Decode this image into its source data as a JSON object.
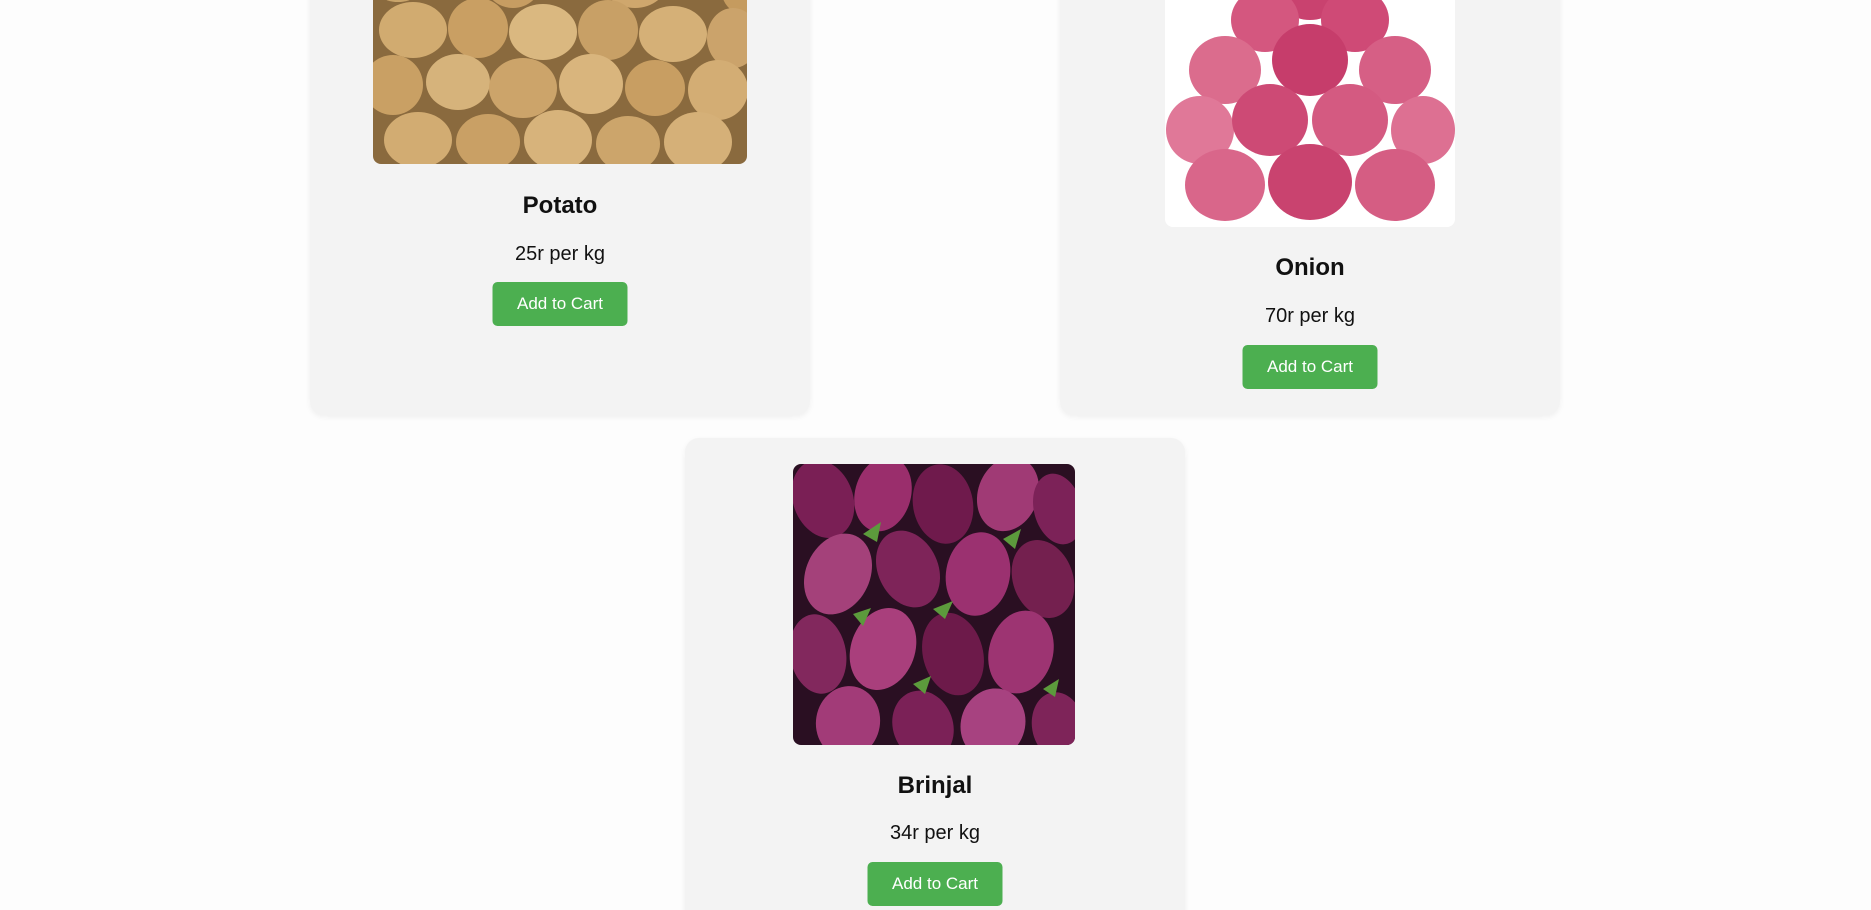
{
  "products": [
    {
      "name": "Potato",
      "price": "25r per kg",
      "button_label": "Add to Cart",
      "image": "potato-photo"
    },
    {
      "name": "Onion",
      "price": "70r per kg",
      "button_label": "Add to Cart",
      "image": "onion-photo"
    },
    {
      "name": "Brinjal",
      "price": "34r per kg",
      "button_label": "Add to Cart",
      "image": "brinjal-photo"
    }
  ],
  "colors": {
    "button": "#4caf50",
    "card": "#f3f3f3",
    "background": "#fdfdfd"
  }
}
